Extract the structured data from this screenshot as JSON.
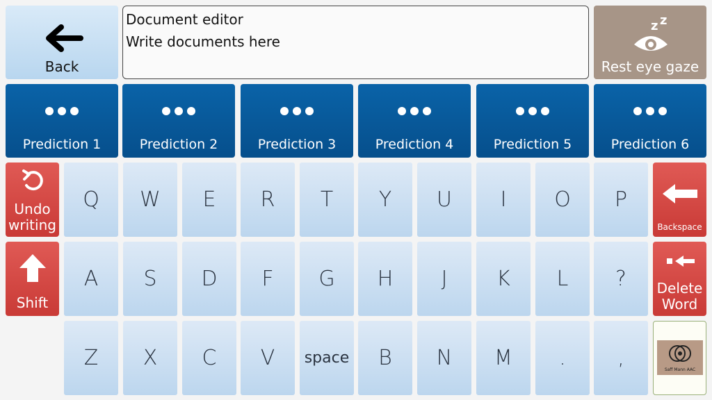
{
  "top": {
    "back_label": "Back",
    "doc_title": "Document editor",
    "doc_text": "Write documents here",
    "rest_label": "Rest eye gaze",
    "rest_icon": "eye-sleep-icon"
  },
  "predictions": [
    "Prediction 1",
    "Prediction 2",
    "Prediction 3",
    "Prediction 4",
    "Prediction 5",
    "Prediction 6"
  ],
  "rows": [
    [
      "Q",
      "W",
      "E",
      "R",
      "T",
      "Y",
      "U",
      "I",
      "O",
      "P"
    ],
    [
      "A",
      "S",
      "D",
      "F",
      "G",
      "H",
      "J",
      "K",
      "L",
      "?"
    ],
    [
      "Z",
      "X",
      "C",
      "V",
      "space",
      "B",
      "N",
      "M",
      ".",
      ","
    ]
  ],
  "side": {
    "undo_line1": "Undo",
    "undo_line2": "writing",
    "shift": "Shift",
    "backspace": "Backspace",
    "delete_line1": "Delete",
    "delete_line2": "Word",
    "logo_text": "Saff Mann AAC"
  },
  "colors": {
    "prediction": "#0a5fa3",
    "key": "#c8def2",
    "action_red": "#d64a45",
    "rest_brown": "#a79587"
  }
}
